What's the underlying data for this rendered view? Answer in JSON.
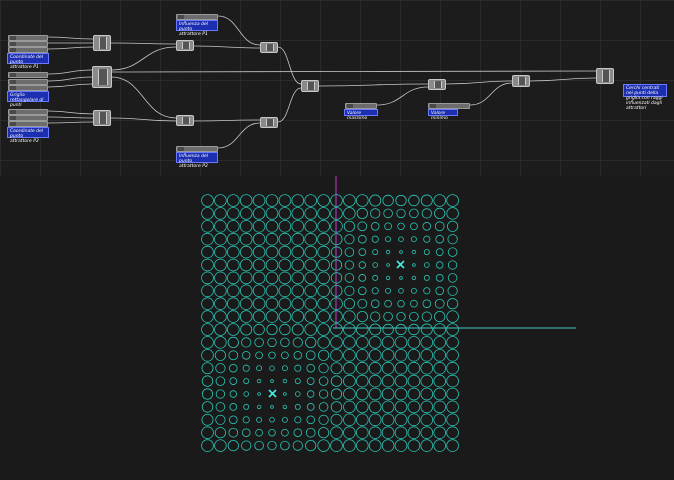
{
  "labels": {
    "coord_p1": "Coordinate del punto attrattore P1",
    "grid": "Griglia rettangolare di punti",
    "coord_p2": "Coordinate del punto attrattore P2",
    "influence_p1": "Influenza del punto attrattore P1",
    "influence_p2": "Influenza del punto attrattore P2",
    "max_value": "Valore massimo",
    "min_value": "Valore minimo",
    "output": "Cerchi centrati nei punti della griglia con raggi influenzati dagli attrattori"
  },
  "colors": {
    "circle": "#2bc4b4",
    "attractor": "#3ff0e0",
    "axis_x": "#3fc8c0",
    "axis_y": "#c83ad0",
    "wire": "#c8c8c8",
    "group": "#1c2fb0"
  },
  "viewport": {
    "grid_cols": 20,
    "grid_rows": 20,
    "attractor_1": [
      15,
      5
    ],
    "attractor_2": [
      5,
      15
    ]
  }
}
